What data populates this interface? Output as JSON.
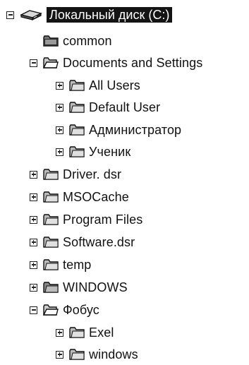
{
  "explorer": {
    "tree": [
      {
        "label": "Локальный диск (C:)",
        "icon": "drive-icon",
        "toggle": "minus",
        "selected": true
      },
      {
        "label": "common",
        "icon": "folder-icon",
        "toggle": "none"
      },
      {
        "label": "Documents and Settings",
        "icon": "open-folder-icon",
        "toggle": "minus"
      },
      {
        "label": "All Users",
        "icon": "folder-icon",
        "toggle": "plus"
      },
      {
        "label": "Default User",
        "icon": "folder-icon",
        "toggle": "plus"
      },
      {
        "label": "Администратор",
        "icon": "folder-icon",
        "toggle": "plus"
      },
      {
        "label": "Ученик",
        "icon": "folder-icon",
        "toggle": "plus"
      },
      {
        "label": "Driver. dsr",
        "icon": "folder-icon",
        "toggle": "plus"
      },
      {
        "label": "MSOCache",
        "icon": "folder-icon",
        "toggle": "plus"
      },
      {
        "label": "Program Files",
        "icon": "folder-icon",
        "toggle": "plus"
      },
      {
        "label": "Software.dsr",
        "icon": "folder-icon",
        "toggle": "plus"
      },
      {
        "label": "temp",
        "icon": "folder-icon",
        "toggle": "plus"
      },
      {
        "label": "WINDOWS",
        "icon": "folder-icon",
        "toggle": "plus"
      },
      {
        "label": "Фобус",
        "icon": "open-folder-icon",
        "toggle": "minus"
      },
      {
        "label": "Exel",
        "icon": "folder-icon",
        "toggle": "plus"
      },
      {
        "label": "windows",
        "icon": "folder-icon",
        "toggle": "plus"
      }
    ]
  }
}
